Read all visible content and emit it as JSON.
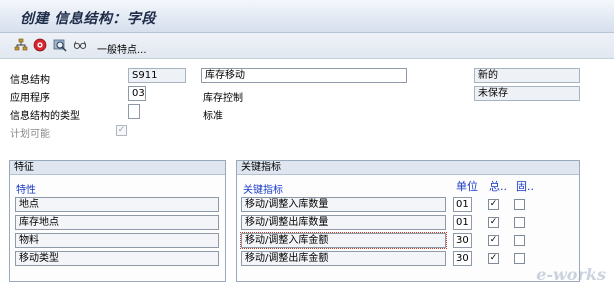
{
  "window": {
    "title": "创建 信息结构：字段"
  },
  "toolbar": {
    "icons": [
      "hierarchy-icon",
      "record-icon",
      "search-icon",
      "glasses-icon"
    ],
    "general_label": "一般特点..."
  },
  "form": {
    "info_structure": {
      "label": "信息结构",
      "code": "S911",
      "description": "库存移动",
      "status": "新的"
    },
    "application": {
      "label": "应用程序",
      "code": "03",
      "description": "库存控制",
      "save_status": "未保存"
    },
    "type": {
      "label": "信息结构的类型",
      "value": "",
      "description": "标准"
    },
    "planning": {
      "label": "计划可能",
      "checked": true
    }
  },
  "characteristics": {
    "title": "特征",
    "column_header": "特性",
    "items": [
      "地点",
      "库存地点",
      "物料",
      "移动类型"
    ]
  },
  "key_figures": {
    "title": "关键指标",
    "column_header": "关键指标",
    "unit_header": "单位",
    "total_header": "总..",
    "fixed_header": "固..",
    "rows": [
      {
        "label": "移动/调整入库数量",
        "unit": "01",
        "total": true,
        "fixed": false
      },
      {
        "label": "移动/调整出库数量",
        "unit": "01",
        "total": true,
        "fixed": false
      },
      {
        "label": "移动/调整入库金额",
        "unit": "30",
        "total": true,
        "fixed": false
      },
      {
        "label": "移动/调整出库金额",
        "unit": "30",
        "total": true,
        "fixed": false
      }
    ]
  },
  "watermark": "e-works"
}
